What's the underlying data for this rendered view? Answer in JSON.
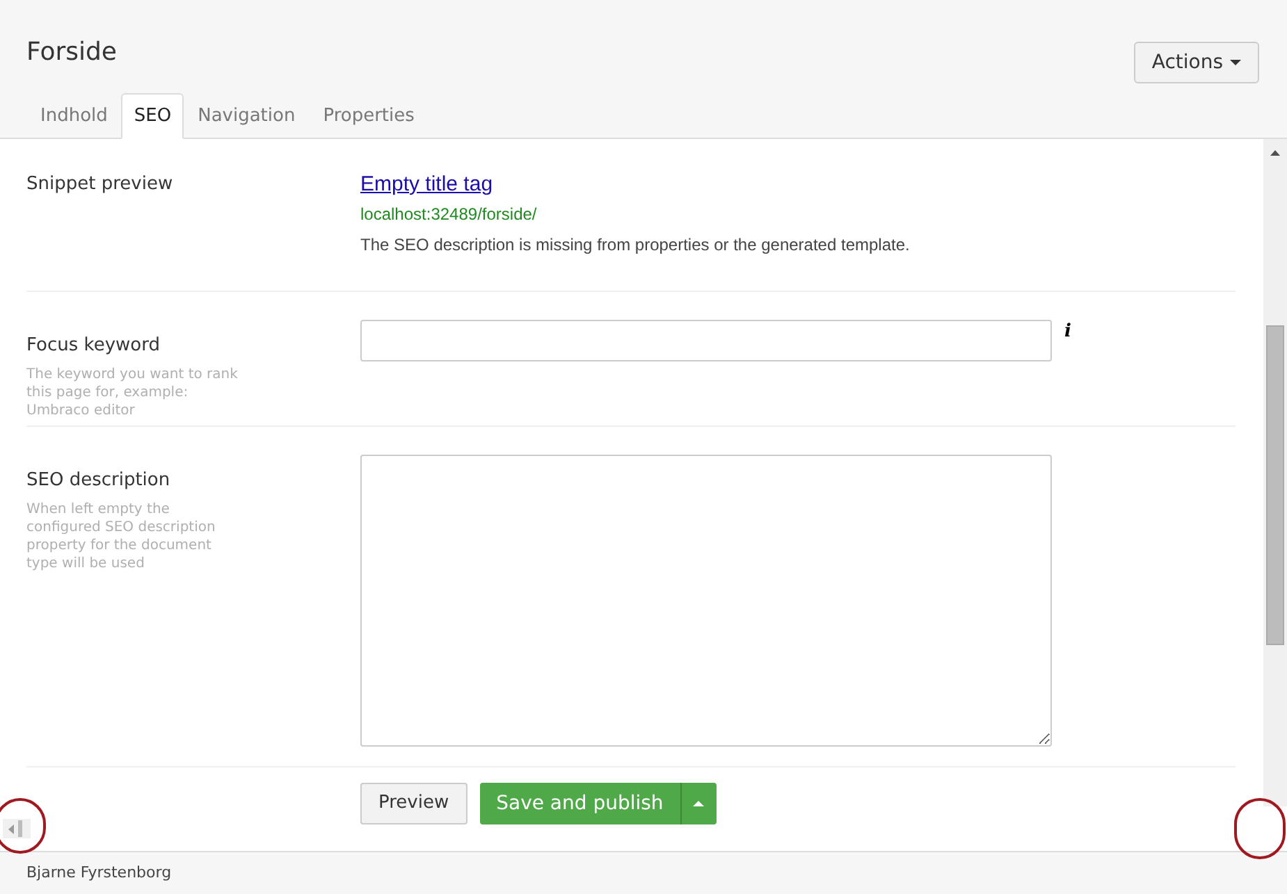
{
  "header": {
    "title": "Forside",
    "actions_button": "Actions"
  },
  "tabs": [
    {
      "label": "Indhold",
      "selected": false
    },
    {
      "label": "SEO",
      "selected": true
    },
    {
      "label": "Navigation",
      "selected": false
    },
    {
      "label": "Properties",
      "selected": false
    }
  ],
  "snippet_preview": {
    "label": "Snippet preview",
    "title_link": "Empty title tag",
    "url": "localhost:32489/forside/",
    "description": "The SEO description is missing from properties or the generated template."
  },
  "focus_keyword": {
    "label": "Focus keyword",
    "help": "The keyword you want to rank this page for, example: Umbraco editor",
    "info_icon": "i"
  },
  "seo_description": {
    "label": "SEO description",
    "help": "When left empty the configured SEO description property for the document type will be used"
  },
  "buttons": {
    "preview": "Preview",
    "save_and_publish": "Save and publish"
  },
  "footer": {
    "user": "Bjarne Fyrstenborg"
  }
}
